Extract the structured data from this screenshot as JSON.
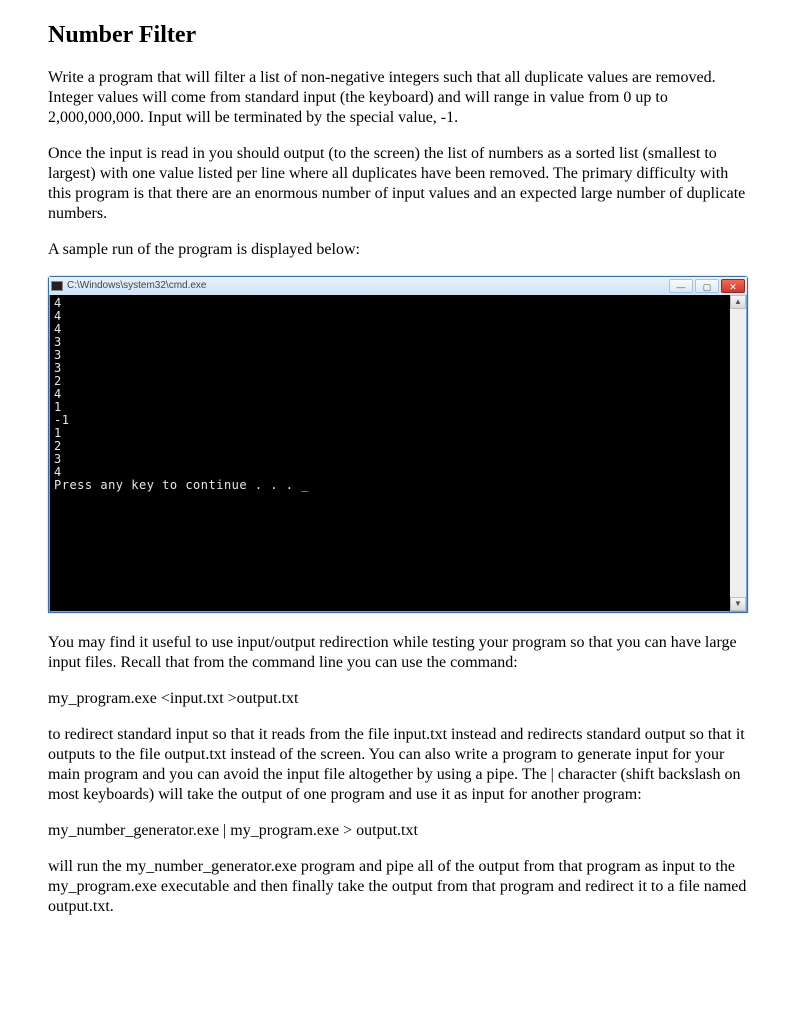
{
  "title": "Number Filter",
  "para1": "Write a program that will filter a list of non-negative integers such that all duplicate values are removed.  Integer values will come from standard input (the keyboard) and will range in value from 0 up to 2,000,000,000.  Input will be terminated by the special value, -1.",
  "para2": "Once the input is read in you should output (to the screen) the list of numbers as a sorted list (smallest to largest) with one value listed per line where all duplicates have been removed.  The primary difficulty with this program is that there are an enormous number of input values and an expected large number of duplicate numbers.",
  "para3": "A sample run of the program is displayed below:",
  "cmd": {
    "title": "C:\\Windows\\system32\\cmd.exe",
    "content": "4\n4\n4\n3\n3\n3\n2\n4\n1\n-1\n1\n2\n3\n4\nPress any key to continue . . . _"
  },
  "para4": "You may find it useful to use input/output redirection while testing your program so that you can have large input files.  Recall that from the command line you can use the command:",
  "cmd1": "my_program.exe  <input.txt    >output.txt",
  "para5": "to redirect standard input so that it reads from the file input.txt instead and redirects standard output so that it outputs to the file output.txt instead of the screen.  You can also write a program to generate input for your main program and you can avoid the input file altogether by using a pipe.  The | character (shift backslash on most keyboards) will take the output of one program and use it as input for another program:",
  "cmd2": "my_number_generator.exe | my_program.exe > output.txt",
  "para6": "will run the my_number_generator.exe program and pipe all of the output from that program as input to the my_program.exe executable and then finally take the output from that program and redirect it to a file named output.txt."
}
